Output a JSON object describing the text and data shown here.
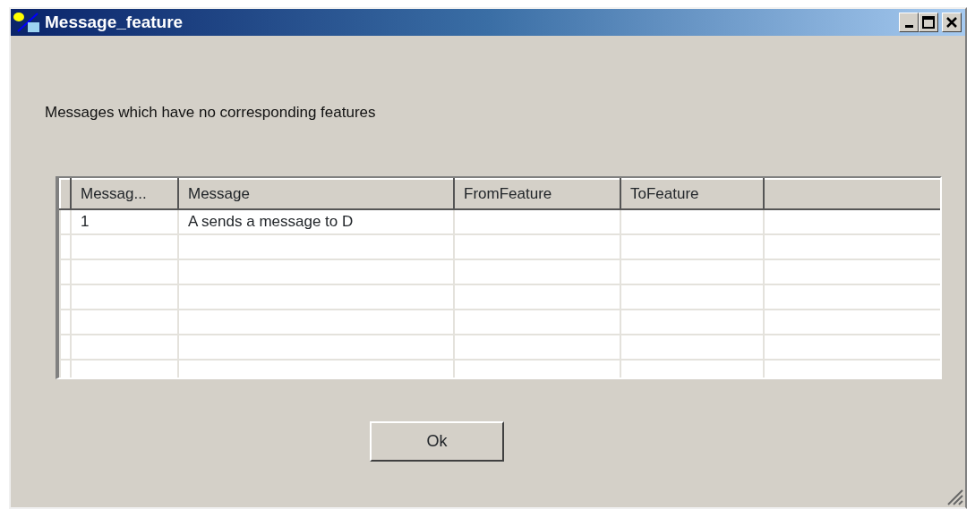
{
  "window": {
    "title": "Message_feature"
  },
  "label": "Messages which have no corresponding features",
  "table": {
    "columns": [
      "Messag...",
      "Message",
      "FromFeature",
      "ToFeature"
    ],
    "rows": [
      [
        "1",
        "A sends a message to D",
        "",
        ""
      ]
    ]
  },
  "buttons": [
    {
      "label": "Ok"
    }
  ]
}
